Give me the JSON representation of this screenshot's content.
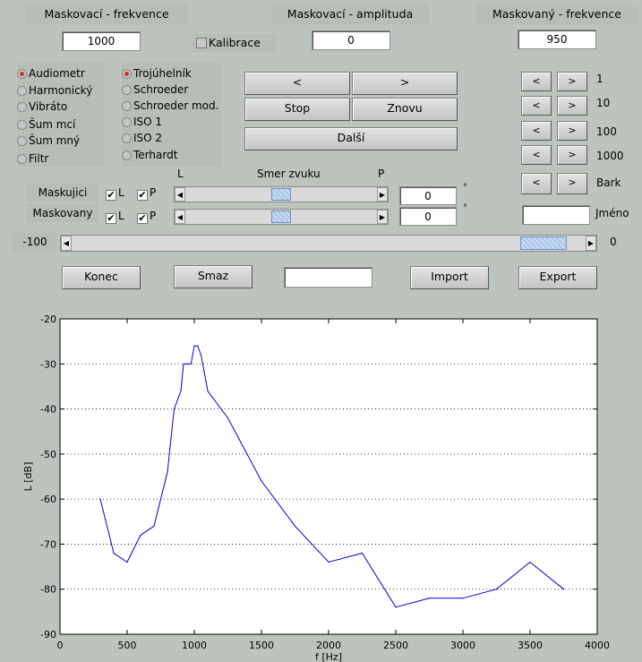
{
  "header": {
    "masking_freq_label": "Maskovací - frekvence",
    "masking_amp_label": "Maskovací - amplituda",
    "masked_freq_label": "Maskovaný - frekvence"
  },
  "fields": {
    "masking_freq": "1000",
    "masking_amp": "0",
    "masked_freq": "950",
    "left_angle_masking": "0",
    "left_angle_masked": "0",
    "name": "",
    "smaz_field": ""
  },
  "calibration": {
    "label": "Kalibrace",
    "checked": false
  },
  "signal_types": [
    "Audiometr",
    "Harmonický",
    "Vibráto",
    "Šum mcí",
    "Šum mný",
    "Filtr"
  ],
  "signal_selected": 0,
  "waveforms": [
    "Trojúhelník",
    "Schroeder",
    "Schroeder mod.",
    "ISO 1",
    "ISO 2",
    "Terhardt"
  ],
  "waveform_selected": 0,
  "buttons": {
    "prev": "<",
    "next": ">",
    "stop": "Stop",
    "again": "Znovu",
    "next_step": "Další",
    "quit": "Konec",
    "delete": "Smaz",
    "import": "Import",
    "export": "Export"
  },
  "step_rows": [
    {
      "minus": "<",
      "plus": ">",
      "label": "1"
    },
    {
      "minus": "<",
      "plus": ">",
      "label": "10"
    },
    {
      "minus": "<",
      "plus": ">",
      "label": "100"
    },
    {
      "minus": "<",
      "plus": ">",
      "label": "1000"
    },
    {
      "minus": "<",
      "plus": ">",
      "label": "Bark"
    }
  ],
  "name_label": "Jméno",
  "direction": {
    "left": "L",
    "title": "Smer zvuku",
    "right": "P",
    "masking_label": "Maskujici",
    "masked_label": "Maskovany",
    "l": "L",
    "p": "P",
    "degree": "°",
    "masking_level": 0.5,
    "masked_level": 0.5
  },
  "amp_slider": {
    "min_label": "-100",
    "max_label": "0",
    "level": 0.96
  },
  "chart_data": {
    "type": "line",
    "xlabel": "f [Hz]",
    "ylabel": "L [dB]",
    "xlim": [
      0,
      4000
    ],
    "ylim": [
      -90,
      -20
    ],
    "xticks": [
      0,
      500,
      1000,
      1500,
      2000,
      2500,
      3000,
      3500,
      4000
    ],
    "yticks": [
      -20,
      -30,
      -40,
      -50,
      -60,
      -70,
      -80,
      -90
    ],
    "grid": "horizontal dotted",
    "color": "#0000cc",
    "x": [
      300,
      400,
      500,
      600,
      700,
      800,
      850,
      900,
      920,
      950,
      975,
      1000,
      1025,
      1050,
      1075,
      1100,
      1250,
      1500,
      1750,
      2000,
      2250,
      2500,
      2750,
      3000,
      3250,
      3500,
      3750
    ],
    "y": [
      -60,
      -72,
      -74,
      -68,
      -66,
      -54,
      -40,
      -36,
      -30,
      -30,
      -30,
      -26,
      -26,
      -28,
      -32,
      -36,
      -42,
      -56,
      -66,
      -74,
      -72,
      -84,
      -82,
      -82,
      -80,
      -74,
      -80
    ]
  }
}
